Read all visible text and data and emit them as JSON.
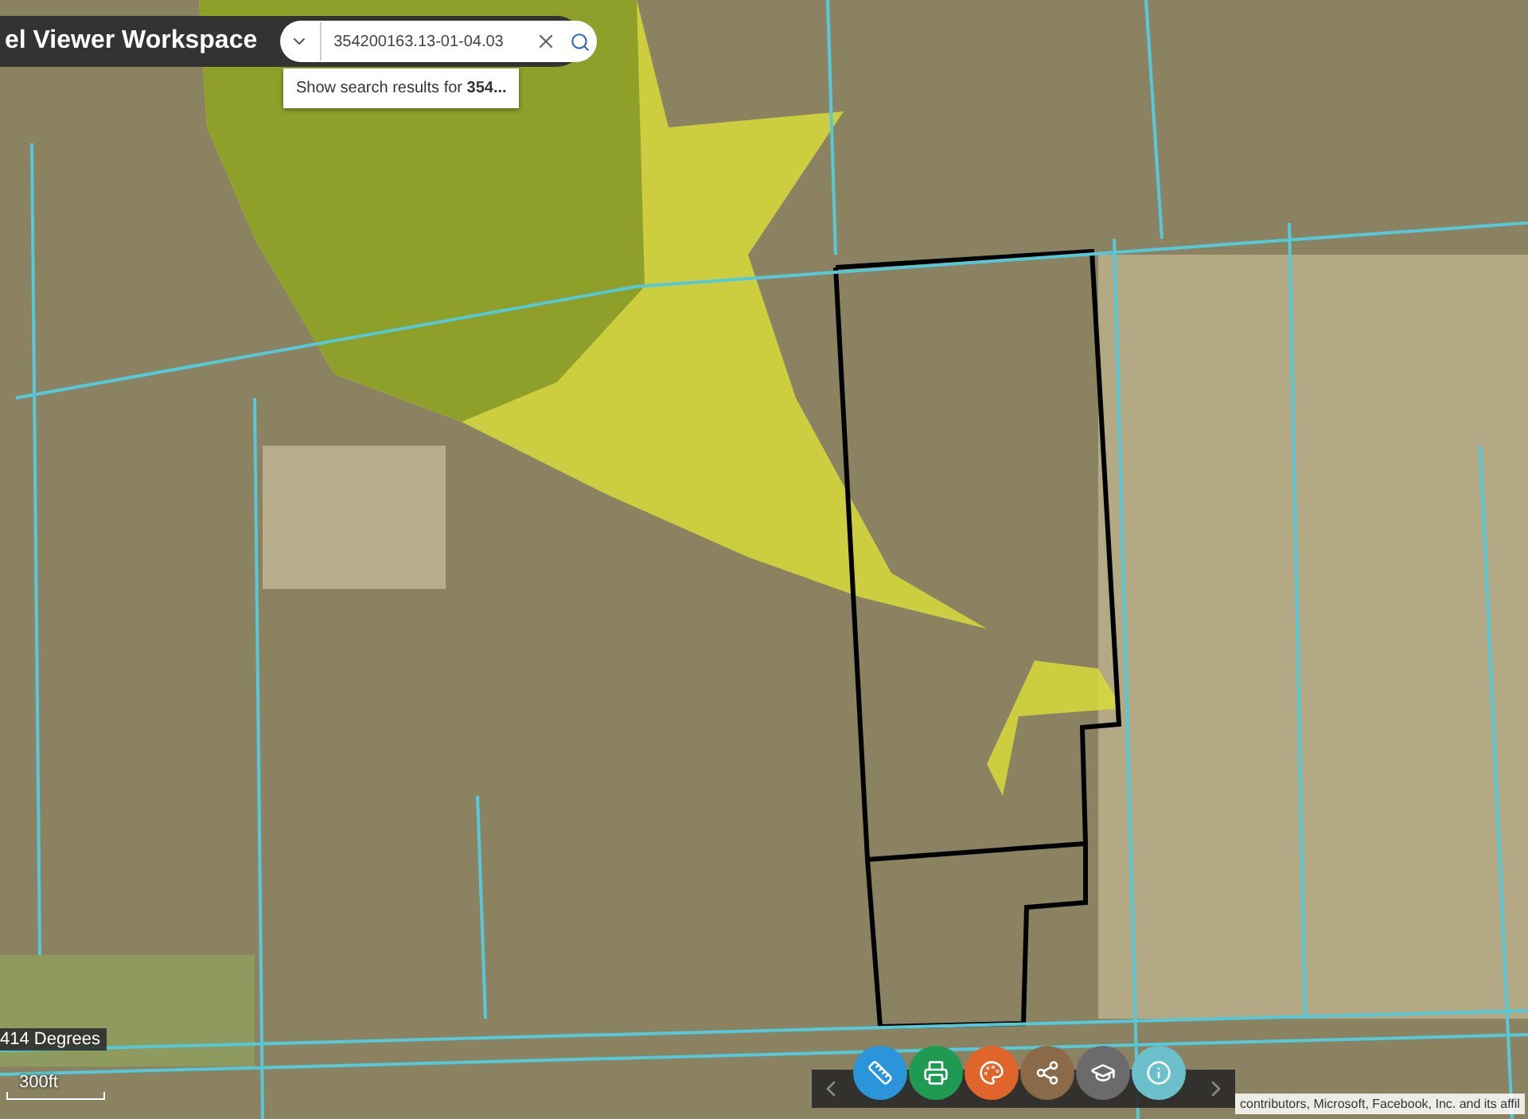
{
  "header": {
    "title": "el Viewer Workspace"
  },
  "search": {
    "value": "354200163.13-01-04.03"
  },
  "suggestion": {
    "text": "Show search results for **354...**"
  },
  "coordinates": "414 Degrees",
  "scale": "300ft",
  "toolbar": {
    "tools": [
      {
        "kind": "measure",
        "color": "#2b95d9"
      },
      {
        "kind": "print",
        "color": "#1e9a52"
      },
      {
        "kind": "palette",
        "color": "#e0652a"
      },
      {
        "kind": "share",
        "color": "#8a6a48"
      },
      {
        "kind": "cap",
        "color": "#6b6b6b"
      },
      {
        "kind": "info",
        "color": "#6cc0cc"
      }
    ]
  },
  "attribution": "contributors, Microsoft, Facebook, Inc. and its affil"
}
